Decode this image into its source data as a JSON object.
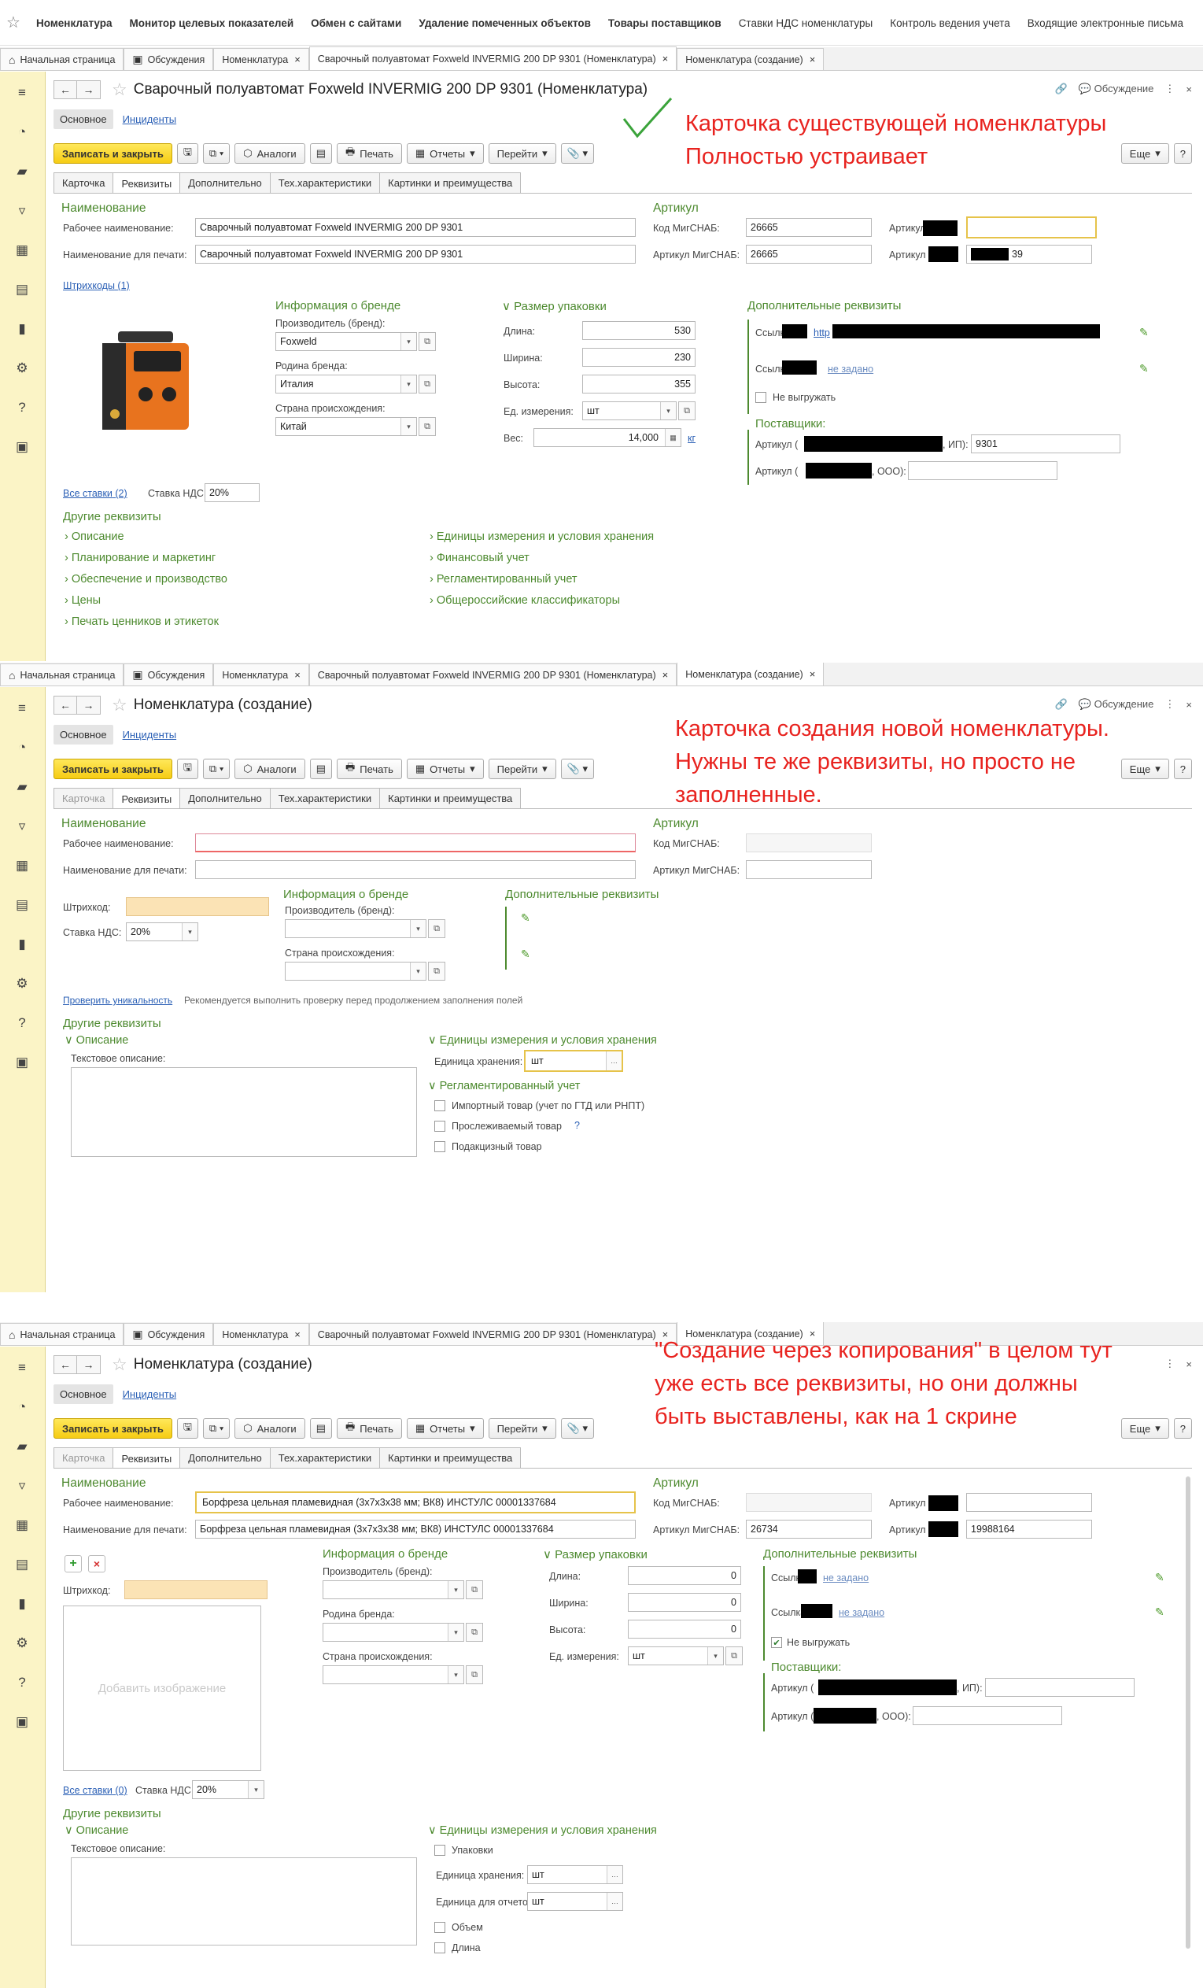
{
  "topnav": {
    "items": [
      "Номенклатура",
      "Монитор целевых показателей",
      "Обмен с сайтами",
      "Удаление помеченных объектов",
      "Товары поставщиков",
      "Ставки НДС номенклатуры",
      "Контроль ведения учета",
      "Входящие электронные письма"
    ]
  },
  "tabs": {
    "home": "Начальная страница",
    "discuss": "Обсуждения",
    "nom": "Номенклатура",
    "welder": "Сварочный полуавтомат Foxweld INVERMIG 200 DP 9301 (Номенклатура)",
    "create": "Номенклатура (создание)"
  },
  "common": {
    "discussion": "Обсуждение",
    "main_tab": "Основное",
    "incidents": "Инциденты",
    "save_close": "Записать и закрыть",
    "analogs": "Аналоги",
    "print": "Печать",
    "reports": "Отчеты",
    "goto": "Перейти",
    "more": "Еще",
    "help": "?",
    "ftabs": [
      "Карточка",
      "Реквизиты",
      "Дополнительно",
      "Тех.характеристики",
      "Картинки и  преимущества"
    ],
    "name_section": "Наименование",
    "work_name": "Рабочее наименование:",
    "print_name": "Наименование для печати:",
    "article_section": "Артикул",
    "mig_code": "Код МигСНАБ:",
    "mig_article": "Артикул МигСНАБ:",
    "article": "Артикул",
    "brand_info": "Информация о бренде",
    "manufacturer": "Производитель (бренд):",
    "brand_country": "Родина бренда:",
    "origin_country": "Страна происхождения:",
    "pack_size": "Размер упаковки",
    "length": "Длина:",
    "width": "Ширина:",
    "height": "Высота:",
    "unit": "Ед. измерения:",
    "weight": "Вес:",
    "kg": "кг",
    "extra": "Дополнительные реквизиты",
    "link_lbl": "Ссылк",
    "link_lbl2": "Ссылка",
    "not_set": "не задано",
    "no_upload": "Не выгружать",
    "suppliers": "Поставщики:",
    "article_sup": "Артикул (",
    "ip_suffix": ", ИП):",
    "ooo_suffix": ", ООО):",
    "all_rates": "Все ставки",
    "vat_rate": "Ставка НДС:",
    "barcode": "Штрихкод:",
    "barcodes": "Штрихкоды",
    "other": "Другие реквизиты",
    "description": "Описание",
    "text_desc": "Текстовое описание:",
    "units_storage": "Единицы измерения и условия хранения",
    "storage_unit": "Единица хранения:",
    "report_unit": "Единица для отчетов:",
    "packages": "Упаковки",
    "volume": "Объем",
    "length_cb": "Длина",
    "check_unique": "Проверить уникальность",
    "check_hint": "Рекомендуется выполнить проверку перед продолжением заполнения полей",
    "regl": "Регламентированный учет",
    "import_goods": "Импортный товар (учет по ГТД или РНПТ)",
    "traceable": "Прослеживаемый товар",
    "excise": "Подакцизный товар",
    "add_image": "Добавить изображение"
  },
  "p1": {
    "title": "Сварочный полуавтомат Foxweld INVERMIG 200 DP 9301 (Номенклатура)",
    "work_name": "Сварочный полуавтомат Foxweld INVERMIG 200 DP 9301",
    "print_name": "Сварочный полуавтомат Foxweld INVERMIG 200 DP 9301",
    "mig_code": "26665",
    "mig_article": "26665",
    "article2": "39",
    "barcodes_count": "(1)",
    "manufacturer": "Foxweld",
    "brand_country": "Италия",
    "origin_country": "Китай",
    "length": "530",
    "width": "230",
    "height": "355",
    "unit": "шт",
    "weight": "14,000",
    "link_val": "http",
    "ip_article": "9301",
    "rates_count": "(2)",
    "vat": "20%",
    "other_left": [
      "Описание",
      "Планирование и маркетинг",
      "Обеспечение и производство",
      "Цены",
      "Печать ценников и этикеток"
    ],
    "other_right": [
      "Единицы измерения и условия хранения",
      "Финансовый учет",
      "Регламентированный учет",
      "Общероссийские классификаторы"
    ],
    "annotation": [
      "Карточка существующей номенклатуры",
      "Полностью устраивает"
    ]
  },
  "p2": {
    "title": "Номенклатура (создание)",
    "vat": "20%",
    "storage_unit": "шт",
    "annotation": [
      "Карточка создания новой номенклатуры.",
      "Нужны те же реквизиты, но просто не",
      "заполненные."
    ]
  },
  "p3": {
    "title": "Номенклатура (создание)",
    "work_name": "Борфреза цельная пламевидная (3х7х3х38 мм; ВК8) ИНСТУЛС 00001337684",
    "print_name": "Борфреза цельная пламевидная (3х7х3х38 мм; ВК8) ИНСТУЛС 00001337684",
    "mig_article": "26734",
    "article2": "19988164",
    "length": "0",
    "width": "0",
    "height": "0",
    "unit": "шт",
    "rates_count": "(0)",
    "vat": "20%",
    "storage_unit": "шт",
    "report_unit": "шт",
    "annotation": [
      "\"Создание через копирования\" в целом тут",
      "уже есть все реквизиты, но они должны",
      "быть выставлены, как на 1 скрине"
    ]
  },
  "colors": {
    "accent_green": "#4d8a2f",
    "annotation_red": "#e8231f",
    "save_yellow": "#f6cc14",
    "sidebar": "#fbf4c6"
  }
}
